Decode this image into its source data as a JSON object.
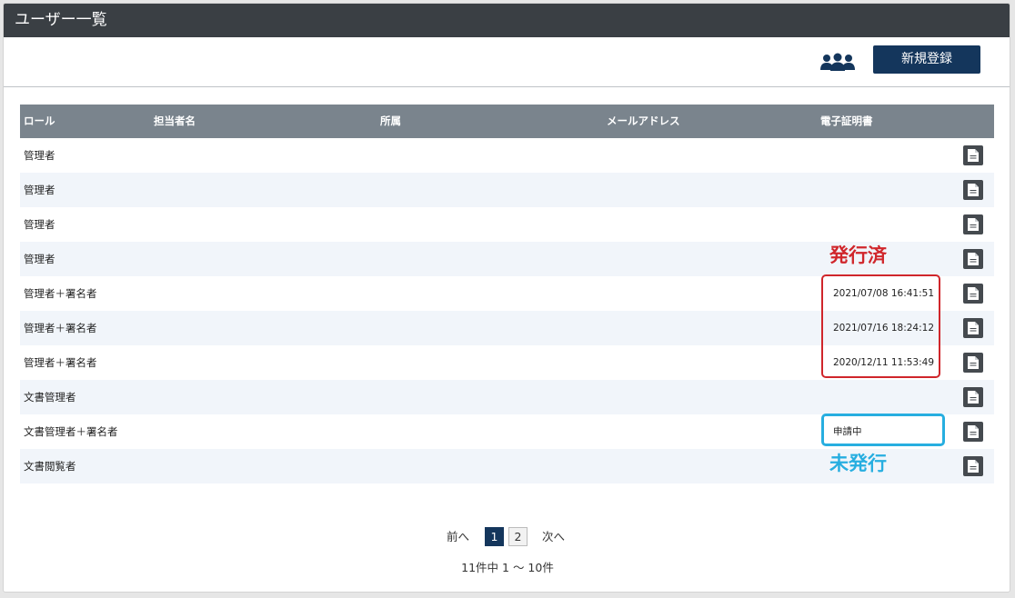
{
  "window": {
    "title": "ユーザー一覧"
  },
  "toolbar": {
    "users_icon": "users-icon",
    "new_button_label": "新規登録",
    "accent": "#14365c"
  },
  "table": {
    "headers": {
      "role": "ロール",
      "name": "担当者名",
      "dept": "所属",
      "email": "メールアドレス",
      "cert": "電子証明書"
    },
    "rows": [
      {
        "role": "管理者",
        "cert": ""
      },
      {
        "role": "管理者",
        "cert": ""
      },
      {
        "role": "管理者",
        "cert": ""
      },
      {
        "role": "管理者",
        "cert": ""
      },
      {
        "role": "管理者＋署名者",
        "cert": "2021/07/08 16:41:51"
      },
      {
        "role": "管理者＋署名者",
        "cert": "2021/07/16 18:24:12"
      },
      {
        "role": "管理者＋署名者",
        "cert": "2020/12/11 11:53:49"
      },
      {
        "role": "文書管理者",
        "cert": ""
      },
      {
        "role": "文書管理者＋署名者",
        "cert": "申請中"
      },
      {
        "role": "文書閲覧者",
        "cert": ""
      }
    ],
    "row_action_icon": "document-icon"
  },
  "annotations": {
    "issued": "発行済",
    "not_issued": "未発行",
    "issued_color": "#d0262b",
    "not_issued_color": "#27aee0"
  },
  "pagination": {
    "prev": "前へ",
    "pages": [
      "1",
      "2"
    ],
    "current": "1",
    "next": "次へ",
    "summary": "11件中 1 ～ 10件"
  }
}
